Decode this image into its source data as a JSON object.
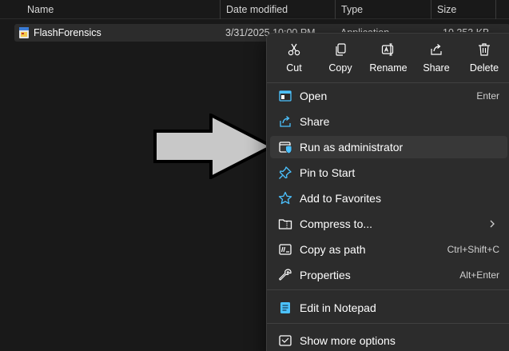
{
  "columns": {
    "name": "Name",
    "date_modified": "Date modified",
    "type": "Type",
    "size": "Size"
  },
  "file": {
    "name": "FlashForensics",
    "date": "3/31/2025 10:00 PM",
    "type": "Application",
    "size": "10,353 KB"
  },
  "quick_actions": {
    "cut": "Cut",
    "copy": "Copy",
    "rename": "Rename",
    "share": "Share",
    "delete": "Delete"
  },
  "menu": {
    "open": {
      "label": "Open",
      "shortcut": "Enter"
    },
    "share": {
      "label": "Share"
    },
    "run_as_admin": {
      "label": "Run as administrator"
    },
    "pin_to_start": {
      "label": "Pin to Start"
    },
    "add_to_favorites": {
      "label": "Add to Favorites"
    },
    "compress_to": {
      "label": "Compress to..."
    },
    "copy_as_path": {
      "label": "Copy as path",
      "shortcut": "Ctrl+Shift+C"
    },
    "properties": {
      "label": "Properties",
      "shortcut": "Alt+Enter"
    },
    "edit_in_notepad": {
      "label": "Edit in Notepad"
    },
    "show_more_options": {
      "label": "Show more options"
    }
  },
  "icons": {
    "open": "window-icon",
    "share": "share-icon",
    "run_as_admin": "shield-window-icon",
    "pin": "pin-icon",
    "favorites": "star-icon",
    "compress": "zip-folder-icon",
    "copy_path": "path-icon",
    "properties": "wrench-icon",
    "notepad": "notepad-icon",
    "more_options": "more-options-icon"
  },
  "colors": {
    "background": "#191919",
    "menu_bg": "#2c2c2c",
    "accent": "#4cc2ff",
    "hover": "#383838"
  }
}
